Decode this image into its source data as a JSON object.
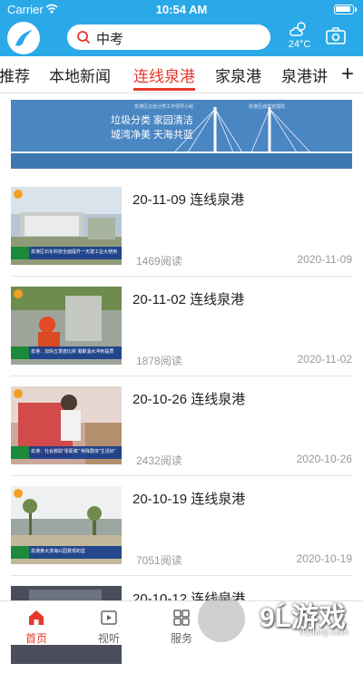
{
  "status_bar": {
    "carrier": "Carrier",
    "time": "10:54 AM"
  },
  "header": {
    "search_query": "中考",
    "temperature": "24°C"
  },
  "tabs": [
    {
      "label": "推荐"
    },
    {
      "label": "本地新闻"
    },
    {
      "label": "连线泉港"
    },
    {
      "label": "家泉港"
    },
    {
      "label": "泉港讲"
    }
  ],
  "active_tab": "连线泉港",
  "add_tab_symbol": "+",
  "banner": {
    "small_left": "泉港区垃圾分类工作领导小组",
    "line1": "垃圾分类 家园清洁",
    "line2": "城湾净美 天海共蓝",
    "small_right": "泉港区城市管理局"
  },
  "articles": [
    {
      "title": "20-11-09 连线泉港",
      "reads": "1469阅读",
      "date": "2020-11-09",
      "caption": "泉港区石化科技全面提升一天建工业大使用"
    },
    {
      "title": "20-11-02 连线泉港",
      "reads": "1878阅读",
      "date": "2020-11-02",
      "caption": "泉港：加快五季度比拼 凝聚温水冲刺提质"
    },
    {
      "title": "20-10-26 连线泉港",
      "reads": "2432阅读",
      "date": "2020-10-26",
      "caption": "泉港：社会救助\"零距离\" 特殊群体\"生活好\""
    },
    {
      "title": "20-10-19 连线泉港",
      "reads": "7051阅读",
      "date": "2020-10-19",
      "caption": "泉港黄大滨海公园景观初显"
    },
    {
      "title": "20-10-12 连线泉港",
      "reads": "",
      "date": "",
      "caption": ""
    }
  ],
  "bottom_nav": [
    {
      "label": "首页"
    },
    {
      "label": "视听"
    },
    {
      "label": "服务"
    }
  ],
  "watermark": {
    "text": "9Ĺ游戏",
    "url": "91danji.com"
  },
  "colors": {
    "header": "#2aa9e8",
    "accent": "#e8382c",
    "banner": "#4a86c2"
  }
}
